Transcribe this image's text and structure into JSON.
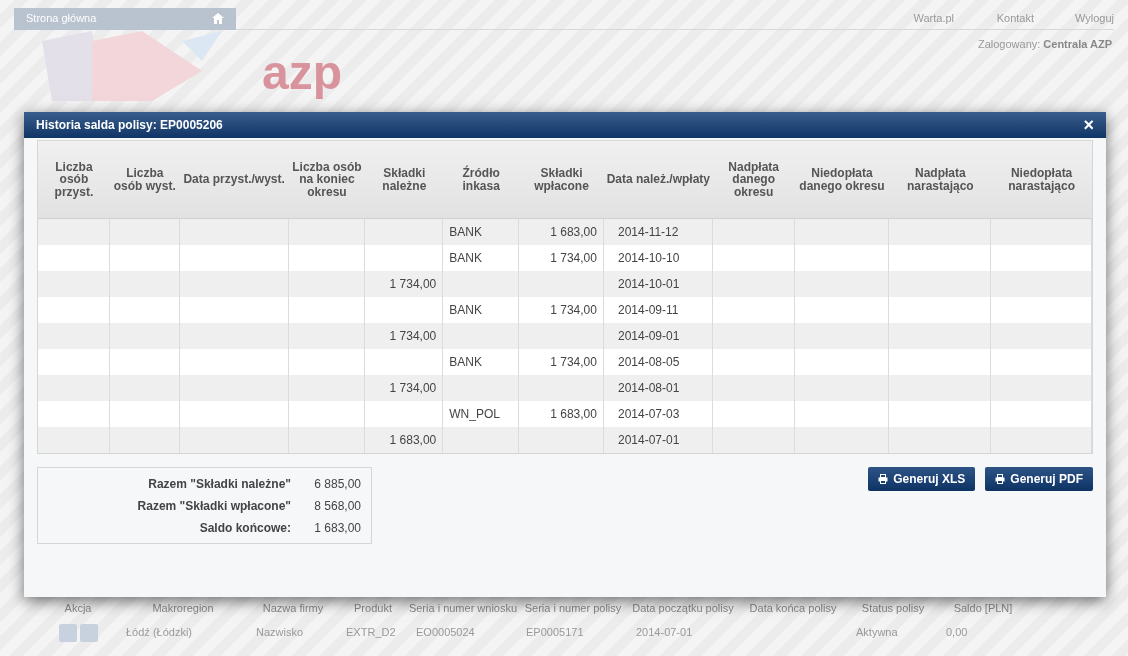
{
  "topbar": {
    "home": "Strona główna",
    "links": [
      "Warta.pl",
      "Kontakt",
      "Wyloguj"
    ],
    "logged_label": "Zalogowany:",
    "logged_user": "Centrala AZP",
    "logo": "azp"
  },
  "background_table": {
    "columns": [
      "Akcja",
      "Makroregion",
      "Nazwa firmy",
      "Produkt",
      "Seria i numer wniosku",
      "Seria i numer polisy",
      "Data początku polisy",
      "Data końca polisy",
      "Status polisy",
      "Saldo [PLN]"
    ],
    "row": {
      "region": "Łódź (Łódzki)",
      "company": "Nazwisko",
      "product": "EXTR_D2",
      "application": "EO0005024",
      "policy": "EP0005171",
      "start": "2014-07-01",
      "status": "Aktywna",
      "balance": "0,00"
    }
  },
  "dialog": {
    "title": "Historia salda polisy: EP0005206",
    "close": "×",
    "columns": [
      "Liczba osób przyst.",
      "Liczba osób wyst.",
      "Data przyst./wyst.",
      "Liczba osób na koniec okresu",
      "Składki należne",
      "Źródło inkasa",
      "Składki wpłacone",
      "Data należ./wpłaty",
      "Nadpłata danego okresu",
      "Niedopłata danego okresu",
      "Nadpłata narastająco",
      "Niedopłata narastająco"
    ],
    "rows": [
      {
        "due": "",
        "source": "BANK",
        "paid": "1 683,00",
        "date": "2014-11-12"
      },
      {
        "due": "",
        "source": "BANK",
        "paid": "1 734,00",
        "date": "2014-10-10"
      },
      {
        "due": "1 734,00",
        "source": "",
        "paid": "",
        "date": "2014-10-01"
      },
      {
        "due": "",
        "source": "BANK",
        "paid": "1 734,00",
        "date": "2014-09-11"
      },
      {
        "due": "1 734,00",
        "source": "",
        "paid": "",
        "date": "2014-09-01"
      },
      {
        "due": "",
        "source": "BANK",
        "paid": "1 734,00",
        "date": "2014-08-05"
      },
      {
        "due": "1 734,00",
        "source": "",
        "paid": "",
        "date": "2014-08-01"
      },
      {
        "due": "",
        "source": "WN_POL",
        "paid": "1 683,00",
        "date": "2014-07-03"
      },
      {
        "due": "1 683,00",
        "source": "",
        "paid": "",
        "date": "2014-07-01"
      }
    ],
    "summary": [
      {
        "label": "Razem \"Składki należne\"",
        "value": "6 885,00"
      },
      {
        "label": "Razem \"Składki wpłacone\"",
        "value": "8 568,00"
      },
      {
        "label": "Saldo końcowe:",
        "value": "1 683,00"
      }
    ],
    "buttons": [
      "Generuj XLS",
      "Generuj PDF"
    ]
  }
}
